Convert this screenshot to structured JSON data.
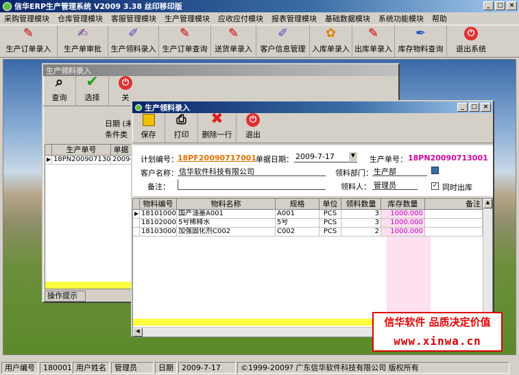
{
  "app": {
    "title": "信华ERP生产管理系统 V2009 3.38 丝印移印版"
  },
  "menu": [
    "采购管理模块",
    "仓库管理模块",
    "客服管理模块",
    "生产管理模块",
    "应收应付模块",
    "报表管理模块",
    "基础数据模块",
    "系统功能模块",
    "帮助"
  ],
  "toolbar": [
    {
      "label": "生产订单录入",
      "icon": "document-pencil-icon"
    },
    {
      "label": "生产单审批",
      "icon": "approve-icon"
    },
    {
      "label": "生产领料录入",
      "icon": "materials-icon"
    },
    {
      "label": "生产订单查询",
      "icon": "order-query-icon"
    },
    {
      "label": "送货单录入",
      "icon": "delivery-icon"
    },
    {
      "label": "客户信息管理",
      "icon": "customer-icon"
    },
    {
      "label": "入库单录入",
      "icon": "stock-in-icon"
    },
    {
      "label": "出库单录入",
      "icon": "stock-out-icon"
    },
    {
      "label": "库存物料查询",
      "icon": "stock-query-icon"
    },
    {
      "label": "退出系统",
      "icon": "power-icon"
    }
  ],
  "bgwin": {
    "title": "生产领料录入",
    "buttons": {
      "query": "查询",
      "select": "选择",
      "close": "关"
    },
    "date_label": "日期 (未",
    "cond_label": "条件类",
    "col1": "生产单号",
    "col2": "单据",
    "row1_c1": "18PN20090713001",
    "row1_c2": "2009-",
    "hint": "操作提示"
  },
  "fgwin": {
    "title": "生产领料录入",
    "buttons": {
      "save": "保存",
      "print": "打印",
      "delete_row": "删除一行",
      "exit": "退出"
    },
    "plan_no_label": "计划编号：",
    "plan_no": "18PF20090717001",
    "doc_date_label": "单据日期：",
    "doc_date": "2009-7-17",
    "prod_no_label": "生产单号：",
    "prod_no": "18PN20090713001",
    "customer_label": "客户名称：",
    "customer": "信华软件科技有限公司",
    "dept_label": "领料部门：",
    "dept": "生产部",
    "remark_label": "备注：",
    "remark": "",
    "picker_label": "领料人：",
    "picker": "管理员",
    "same_out_label": "同时出库",
    "same_out_checked": "✓",
    "columns": [
      "物料编号",
      "物料名称",
      "规格",
      "单位",
      "领料数量",
      "库存数量",
      "备注"
    ],
    "rows": [
      {
        "code": "1810100001",
        "name": "国产油墨A001",
        "spec": "A001",
        "unit": "PCS",
        "qty": "3",
        "stock": "1000.000",
        "remark": ""
      },
      {
        "code": "1810200001",
        "name": "5号稀释水",
        "spec": "5号",
        "unit": "PCS",
        "qty": "3",
        "stock": "1000.000",
        "remark": ""
      },
      {
        "code": "1810300002",
        "name": "加强固化剂C002",
        "spec": "C002",
        "unit": "PCS",
        "qty": "2",
        "stock": "1000.000",
        "remark": ""
      }
    ]
  },
  "watermark": {
    "line1": "信华软件 品质决定价值",
    "line2": "www.xinwa.cn"
  },
  "status": {
    "user_no_label": "用户编号",
    "user_no": "180001",
    "user_name_label": "用户姓名",
    "user_name": "管理员",
    "date_label": "日期",
    "date": "2009-7-17",
    "copyright": "©1999-2009?  广东信华软件科技有限公司  版权所有"
  }
}
